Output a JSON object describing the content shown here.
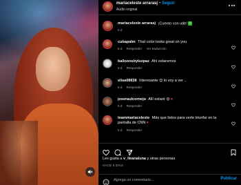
{
  "colors": {
    "accent": "#0095f6",
    "background": "#000000",
    "muted": "#a8a8a8",
    "like_red": "#ed4956"
  },
  "header": {
    "username": "mariaceleste arrarasj",
    "follow_label": "Seguir",
    "audio_label": "Audio original",
    "more_icon": "more-horizontal-icon"
  },
  "caption": {
    "username": "mariaceleste arrarasj",
    "text": "¡Cuento con ude!",
    "time": "5 d"
  },
  "comments": [
    {
      "username": "cubapalm",
      "text": "That color looks great on you",
      "time": "5 d",
      "reply": "Responder",
      "extra": "Ver traducción"
    },
    {
      "username": "balloonsbyluzpaz",
      "text": "Ahí estaremos",
      "time": "5 d",
      "reply": "Responder"
    },
    {
      "username": "elisa08838",
      "text": "Interesante",
      "text2": "lo voy a ver ..",
      "time": "5 d",
      "reply": "Responder"
    },
    {
      "username": "joseraulcornejo",
      "text": "Allí estaré",
      "time": "5 d",
      "reply": "Responder"
    },
    {
      "username": "teammariaceleste",
      "text": "Más que listos para verte triunfar en la pantalla de CNN",
      "time": "5 d",
      "reply": "Responder"
    }
  ],
  "actions": {
    "like_icon": "heart-icon",
    "comment_icon": "comment-icon",
    "share_icon": "send-icon",
    "save_icon": "bookmark-icon"
  },
  "likes": {
    "prefix": "Les gusta a",
    "user": "v_lleanaluna",
    "suffix": "y otras personas"
  },
  "date": "HACE 5 DÍAS",
  "add_comment": {
    "placeholder": "Agrega un comentario...",
    "publish_label": "Publicar"
  }
}
